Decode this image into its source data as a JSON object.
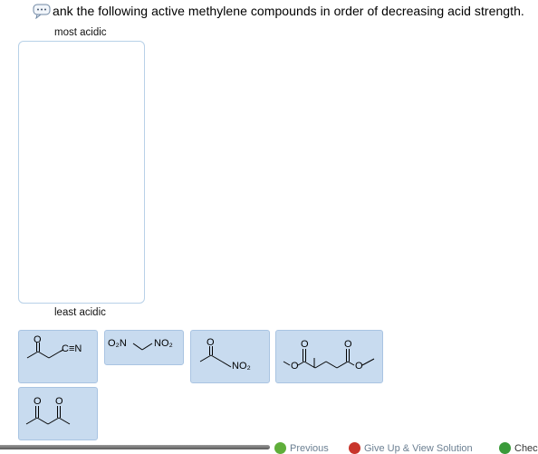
{
  "question": {
    "text": "ank the following active methylene compounds in order of decreasing acid strength.",
    "icon": "speech-bubble-icon"
  },
  "ranking": {
    "top_label": "most acidic",
    "bottom_label": "least acidic"
  },
  "tiles": [
    {
      "name": "acetoacetonitrile",
      "labels": {
        "o": "O",
        "cn": "C≡N"
      }
    },
    {
      "name": "dinitromethane",
      "labels": {
        "left": "O₂N",
        "right": "NO₂"
      }
    },
    {
      "name": "nitroacetone",
      "labels": {
        "o": "O",
        "no2": "NO₂"
      }
    },
    {
      "name": "dimethyl-malonate",
      "labels": {
        "o1": "O",
        "o2": "O",
        "o3": "O",
        "o4": "O"
      }
    },
    {
      "name": "acetylacetone",
      "labels": {
        "o1": "O",
        "o2": "O"
      }
    }
  ],
  "footer": {
    "previous": "Previous",
    "give_up": "Give Up & View Solution",
    "check": "Chec"
  },
  "colors": {
    "tile_bg": "#c8dbef",
    "tile_border": "#a9c4e2",
    "dropzone_border": "#b8d1e8",
    "footer_text": "#6b7f92"
  }
}
